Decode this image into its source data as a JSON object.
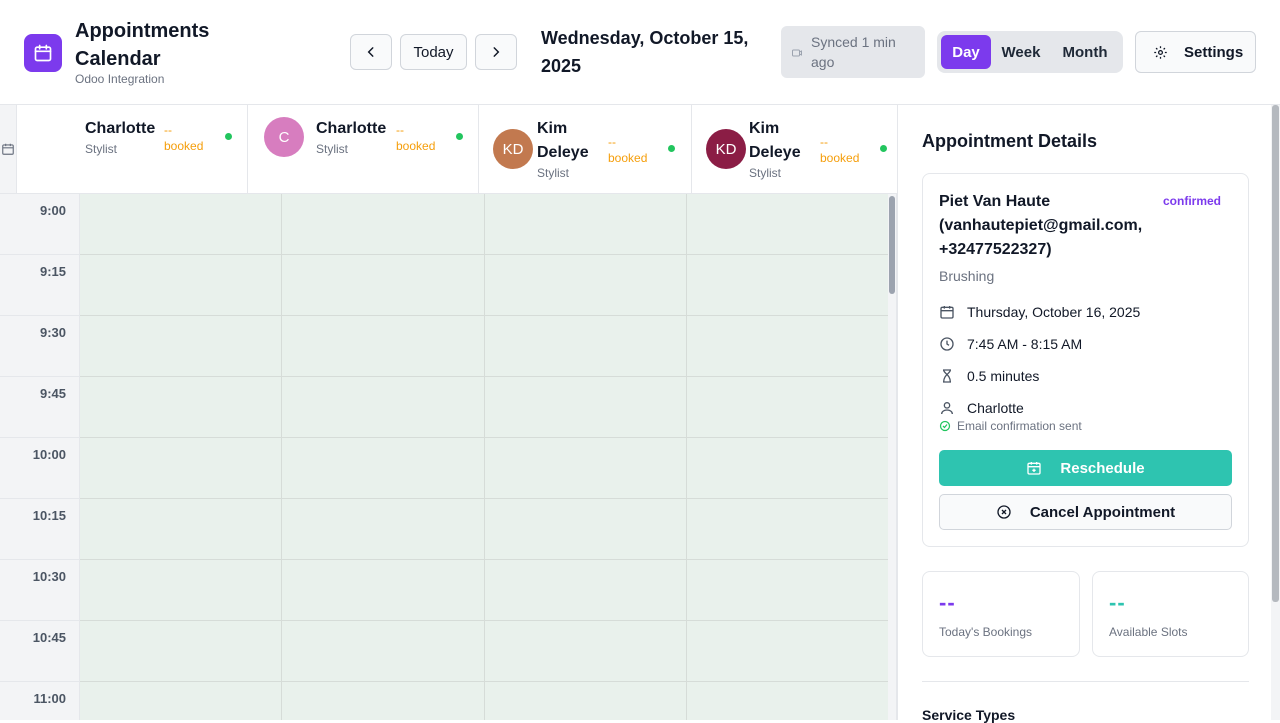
{
  "app": {
    "title": "Appointments Calendar",
    "subtitle": "Odoo Integration"
  },
  "nav": {
    "prev_icon": "chevron-left-icon",
    "today_label": "Today",
    "next_icon": "chevron-right-icon"
  },
  "current_date": "Wednesday, October 15, 2025",
  "sync": {
    "text": "Synced 1 min ago",
    "icon": "sync-status-icon"
  },
  "views": {
    "day": "Day",
    "week": "Week",
    "month": "Month",
    "active": "Day"
  },
  "settings_label": "Settings",
  "staff": [
    {
      "name": "Charlotte",
      "role": "Stylist",
      "booked": "-- booked",
      "avatar": ""
    },
    {
      "name": "Charlotte",
      "role": "Stylist",
      "booked": "-- booked",
      "avatar": "C"
    },
    {
      "name": "Kim Deleye",
      "role": "Stylist",
      "booked": "-- booked",
      "avatar": "KD"
    },
    {
      "name": "Kim Deleye",
      "role": "Stylist",
      "booked": "-- booked",
      "avatar": "KD"
    }
  ],
  "times": [
    "9:00",
    "9:15",
    "9:30",
    "9:45",
    "10:00",
    "10:15",
    "10:30",
    "10:45",
    "11:00"
  ],
  "details": {
    "title": "Appointment Details",
    "client": "Piet Van Haute (vanhautepiet@gmail.com, +32477522327)",
    "status": "confirmed",
    "service": "Brushing",
    "date": "Thursday, October 16, 2025",
    "time": "7:45 AM - 8:15 AM",
    "duration": "0.5 minutes",
    "staff": "Charlotte",
    "email_note": "Email confirmation sent",
    "reschedule_label": "Reschedule",
    "cancel_label": "Cancel Appointment"
  },
  "stats": {
    "today_bookings": {
      "value": "--",
      "label": "Today's Bookings"
    },
    "available_slots": {
      "value": "--",
      "label": "Available Slots"
    }
  },
  "service_types_title": "Service Types",
  "colors": {
    "accent": "#7c3aed",
    "teal": "#2ec4b0",
    "booked": "#f59e0b",
    "online": "#22c55e",
    "avatar_pink": "#d77dbf",
    "avatar_brown": "#c2794f",
    "avatar_maroon": "#8b1d45"
  }
}
